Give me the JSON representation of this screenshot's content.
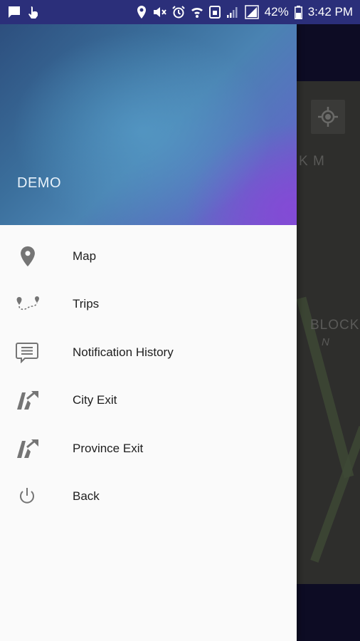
{
  "status_bar": {
    "battery": "42%",
    "time": "3:42 PM"
  },
  "drawer": {
    "header_title": "DEMO",
    "items": [
      {
        "label": "Map",
        "icon": "map-pin-icon"
      },
      {
        "label": "Trips",
        "icon": "trip-route-icon"
      },
      {
        "label": "Notification History",
        "icon": "message-icon"
      },
      {
        "label": "City Exit",
        "icon": "road-exit-icon"
      },
      {
        "label": "Province Exit",
        "icon": "road-exit-icon"
      },
      {
        "label": "Back",
        "icon": "power-icon"
      }
    ]
  },
  "map": {
    "labels": [
      "K M",
      "BLOCK",
      "N"
    ]
  },
  "colors": {
    "status_bar": "#2b2f7a",
    "header_start": "#2d4f7e",
    "header_end": "#7a4fd0",
    "icon_gray": "#757575"
  }
}
